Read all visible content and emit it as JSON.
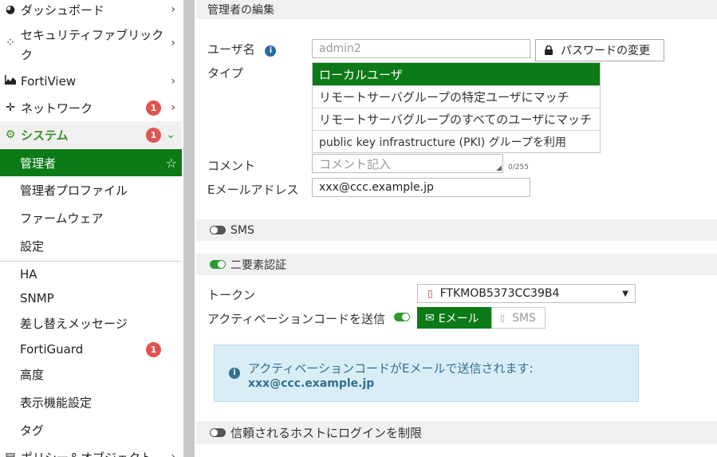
{
  "sidebar": {
    "items": [
      {
        "label": "ダッシュボード",
        "icon": "dashboard-icon"
      },
      {
        "label": "セキュリティファブリック",
        "label_line2": "ク",
        "icon": "fabric-icon"
      },
      {
        "label": "FortiView",
        "icon": "chart-icon"
      },
      {
        "label": "ネットワーク",
        "icon": "network-icon",
        "badge": "1"
      },
      {
        "label": "システム",
        "icon": "gear-icon",
        "badge": "1"
      }
    ],
    "system_sub": [
      {
        "label": "管理者"
      },
      {
        "label": "管理者プロファイル"
      },
      {
        "label": "ファームウェア"
      },
      {
        "label": "設定"
      },
      {
        "label": "HA"
      },
      {
        "label": "SNMP"
      },
      {
        "label": "差し替えメッセージ"
      },
      {
        "label": "FortiGuard",
        "badge": "1"
      },
      {
        "label": "高度"
      },
      {
        "label": "表示機能設定"
      },
      {
        "label": "タグ"
      }
    ],
    "next_item": "ポリシー＆オブジェクト"
  },
  "main": {
    "header": "管理者の編集",
    "username_label": "ユーザ名",
    "username_value": "admin2",
    "change_password_button": "パスワードの変更",
    "type_label": "タイプ",
    "type_options": [
      "ローカルユーザ",
      "リモートサーバグループの特定ユーザにマッチ",
      "リモートサーバグループのすべてのユーザにマッチ",
      "public key infrastructure (PKI) グループを利用"
    ],
    "type_selected_index": 0,
    "comment_label": "コメント",
    "comment_placeholder": "コメント記入",
    "comment_counter": "0/255",
    "email_label": "Eメールアドレス",
    "email_value": "xxx@ccc.example.jp",
    "sms_label": "SMS",
    "sms_enabled": false,
    "twofactor_label": "二要素認証",
    "twofactor_enabled": true,
    "token_label": "トークン",
    "token_value": "FTKMOB5373CC39B4",
    "activation_label": "アクティベーションコードを送信",
    "activation_enabled": true,
    "email_button": "Eメール",
    "sms_button": "SMS",
    "info_line1": "アクティベーションコードがEメールで送信されます:",
    "info_line2": "xxx@ccc.example.jp",
    "trusted_hosts_label": "信頼されるホストにログインを制限",
    "trusted_hosts_enabled": false
  },
  "colors": {
    "accent_green": "#0c7a16",
    "badge_red": "#e0534f",
    "info_bg": "#d9edf7",
    "info_text": "#31708f"
  }
}
